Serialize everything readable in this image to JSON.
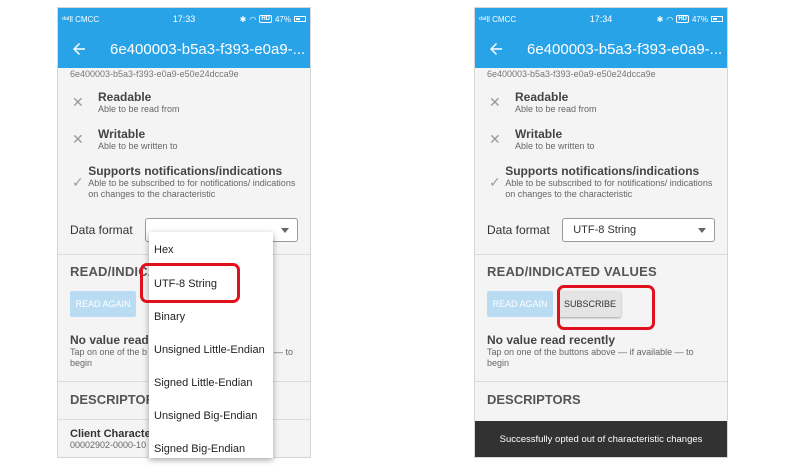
{
  "left": {
    "status": {
      "carrier": "ᵈᵃᴵll CMCC",
      "time": "17:33",
      "hd": "HD",
      "battery": "47%"
    },
    "title": "6e400003-b5a3-f393-e0a9-...",
    "uuid": "6e400003-b5a3-f393-e0a9-e50e24dcca9e",
    "perms": [
      {
        "icon": "close-icon",
        "title": "Readable",
        "desc": "Able to be read from"
      },
      {
        "icon": "close-icon",
        "title": "Writable",
        "desc": "Able to be written to"
      },
      {
        "icon": "check-icon",
        "title": "Supports notifications/indications",
        "desc": "Able to be subscribed to for notifications/ indications on changes to the characteristic"
      }
    ],
    "format_label": "Data format",
    "section_values": "READ/INDICA",
    "read_again": "READ AGAIN",
    "no_value_title": "No value read",
    "no_value_desc_1": "Tap on one of the b",
    "no_value_desc_2": "begin",
    "no_value_desc_tail": "— to",
    "descriptors": "DESCRIPTOR",
    "client_title": "Client Characte",
    "client_uuid": "00002902-0000-10",
    "dropdown_options": [
      "Hex",
      "UTF-8 String",
      "Binary",
      "Unsigned Little-Endian",
      "Signed Little-Endian",
      "Unsigned Big-Endian",
      "Signed Big-Endian"
    ]
  },
  "right": {
    "status": {
      "carrier": "ᵈᵃᴵll CMCC",
      "time": "17:34",
      "hd": "HD",
      "battery": "47%"
    },
    "title": "6e400003-b5a3-f393-e0a9-...",
    "uuid": "6e400003-b5a3-f393-e0a9-e50e24dcca9e",
    "perms": [
      {
        "icon": "close-icon",
        "title": "Readable",
        "desc": "Able to be read from"
      },
      {
        "icon": "close-icon",
        "title": "Writable",
        "desc": "Able to be written to"
      },
      {
        "icon": "check-icon",
        "title": "Supports notifications/indications",
        "desc": "Able to be subscribed to for notifications/ indications on changes to the characteristic"
      }
    ],
    "format_label": "Data format",
    "format_value": "UTF-8 String",
    "section_values": "READ/INDICATED VALUES",
    "read_again": "READ AGAIN",
    "subscribe": "SUBSCRIBE",
    "no_value_title": "No value read recently",
    "no_value_desc": "Tap on one of the buttons above — if available — to begin",
    "descriptors": "DESCRIPTORS",
    "toast": "Successfully opted out of characteristic changes"
  },
  "colors": {
    "appbar": "#29a3e8",
    "highlight": "#e0101c",
    "toast": "#323232"
  }
}
